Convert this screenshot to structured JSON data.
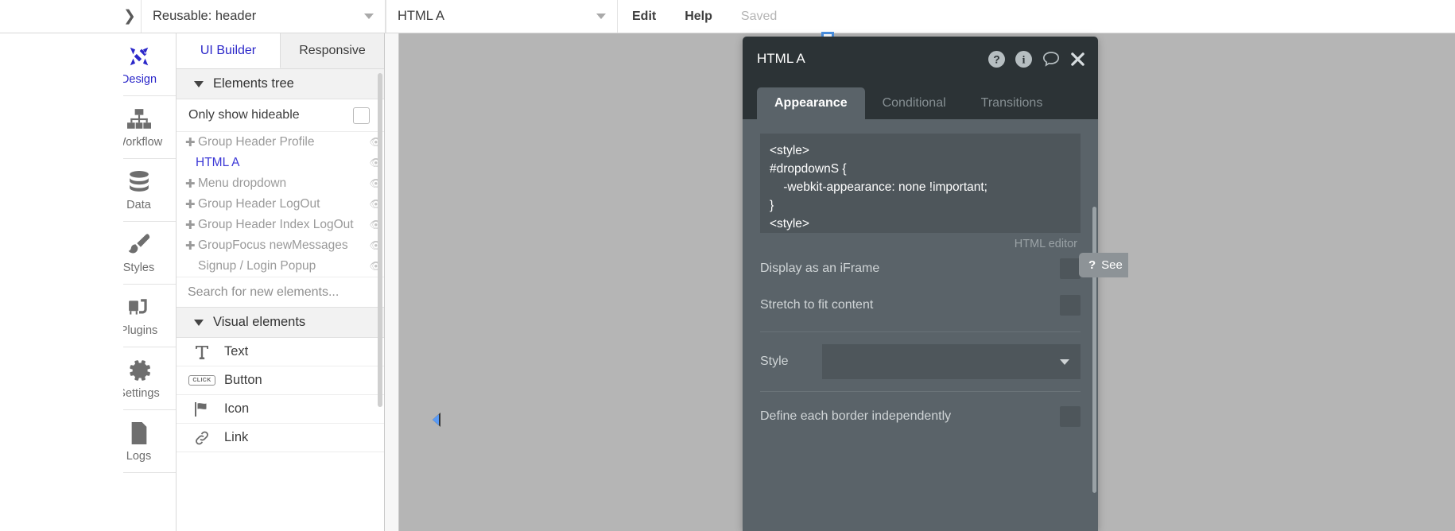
{
  "topbar": {
    "back_icon": "back-arrow-icon",
    "page_selector": {
      "value": "Reusable: header",
      "caret": "chevron-down-icon"
    },
    "element_selector": {
      "value": "HTML A",
      "caret": "chevron-down-icon"
    },
    "edit_label": "Edit",
    "help_label": "Help",
    "saved_label": "Saved"
  },
  "rail": {
    "items": [
      {
        "label": "Design",
        "icon": "design-icon",
        "active": true
      },
      {
        "label": "Workflow",
        "icon": "workflow-icon",
        "active": false
      },
      {
        "label": "Data",
        "icon": "database-icon",
        "active": false
      },
      {
        "label": "Styles",
        "icon": "brush-icon",
        "active": false
      },
      {
        "label": "Plugins",
        "icon": "plugins-icon",
        "active": false
      },
      {
        "label": "Settings",
        "icon": "gear-icon",
        "active": false
      },
      {
        "label": "Logs",
        "icon": "document-icon",
        "active": false
      }
    ]
  },
  "elements_panel": {
    "tabs": [
      {
        "label": "UI Builder",
        "active": true
      },
      {
        "label": "Responsive",
        "active": false
      }
    ],
    "section_tree_title": "Elements tree",
    "only_show_hideable": "Only show hideable",
    "tree": [
      {
        "label": "Group Header Profile",
        "expandable": true,
        "selected": false
      },
      {
        "label": "HTML A",
        "expandable": false,
        "selected": true
      },
      {
        "label": "Menu dropdown",
        "expandable": true,
        "selected": false
      },
      {
        "label": "Group Header LogOut",
        "expandable": true,
        "selected": false
      },
      {
        "label": "Group Header Index LogOut",
        "expandable": true,
        "selected": false
      },
      {
        "label": "GroupFocus newMessages",
        "expandable": true,
        "selected": false
      },
      {
        "label": "Signup / Login Popup",
        "expandable": false,
        "selected": false
      }
    ],
    "search_placeholder": "Search for new elements...",
    "section_visual_title": "Visual elements",
    "visual_elements": [
      {
        "label": "Text",
        "icon": "text-icon"
      },
      {
        "label": "Button",
        "icon": "button-icon",
        "chip": "CLICK"
      },
      {
        "label": "Icon",
        "icon": "flag-icon"
      },
      {
        "label": "Link",
        "icon": "link-icon"
      }
    ]
  },
  "canvas": {
    "collapse_arrow": "collapse-left-arrow-icon",
    "selection": "selected-element-handles"
  },
  "property_panel": {
    "title": "HTML A",
    "header_icons": [
      "help-circle-icon",
      "info-circle-icon",
      "comment-icon",
      "close-icon"
    ],
    "tabs": [
      {
        "label": "Appearance",
        "active": true
      },
      {
        "label": "Conditional",
        "active": false
      },
      {
        "label": "Transitions",
        "active": false
      }
    ],
    "code": "<style>\n#dropdownS {\n    -webkit-appearance: none !important;\n}\n<style>",
    "code_caption": "HTML editor",
    "rows": [
      {
        "label": "Display as an iFrame",
        "checked": false
      },
      {
        "label": "Stretch to fit content",
        "checked": false
      }
    ],
    "style_label": "Style",
    "style_value": "",
    "border_row": {
      "label": "Define each border independently",
      "checked": false
    }
  },
  "help_tab": {
    "icon": "question-mark-icon",
    "label": "See"
  }
}
